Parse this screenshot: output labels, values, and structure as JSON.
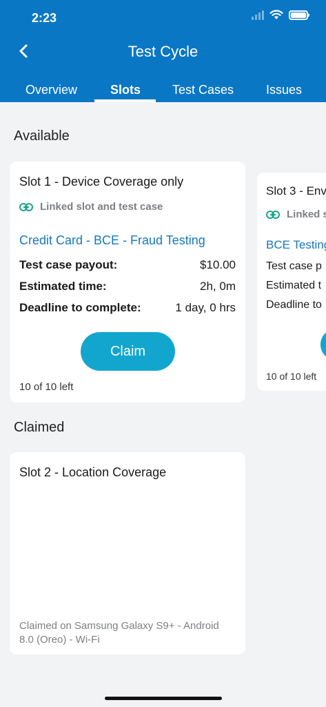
{
  "status_bar": {
    "time": "2:23"
  },
  "header": {
    "title": "Test Cycle",
    "back_icon": "chevron-left-icon"
  },
  "tabs": [
    {
      "label": "Overview",
      "active": false
    },
    {
      "label": "Slots",
      "active": true
    },
    {
      "label": "Test Cases",
      "active": false
    },
    {
      "label": "Issues",
      "active": false
    }
  ],
  "sections": {
    "available": "Available",
    "claimed": "Claimed"
  },
  "slot1": {
    "title": "Slot 1 - Device Coverage only",
    "linked": "Linked slot and test case",
    "test_case": "Credit Card - BCE - Fraud Testing",
    "rows": [
      {
        "label": "Test case payout:",
        "value": "$10.00"
      },
      {
        "label": "Estimated time:",
        "value": "2h, 0m"
      },
      {
        "label": "Deadline to complete:",
        "value": "1 day, 0 hrs"
      }
    ],
    "claim_label": "Claim",
    "left": "10 of 10 left"
  },
  "slot3": {
    "title": "Slot 3 - Env",
    "linked": "Linked s",
    "test_case": "BCE Testing",
    "rows": [
      {
        "label": "Test case p"
      },
      {
        "label": "Estimated t"
      },
      {
        "label": "Deadline to"
      }
    ],
    "left": "10 of 10 left"
  },
  "slot2": {
    "title": "Slot 2 - Location Coverage",
    "claimed_info": "Claimed on Samsung Galaxy S9+ - Android 8.0 (Oreo) - Wi-Fi"
  },
  "colors": {
    "header": "#0a77c4",
    "accent": "#1677be",
    "button": "#12a6cf",
    "link_icon": "#1aa38a"
  }
}
